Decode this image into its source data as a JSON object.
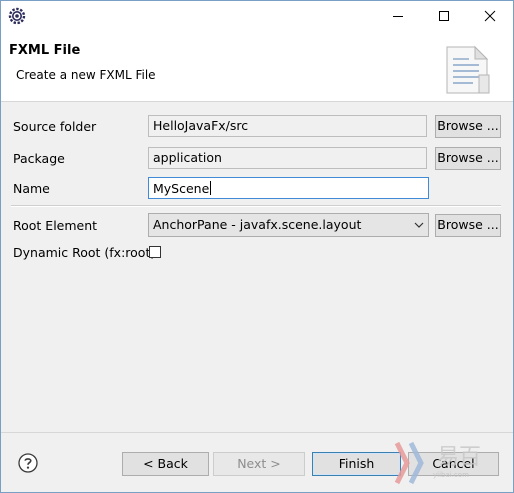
{
  "titlebar": {
    "app_icon": "eclipse-gear-icon",
    "minimize_icon": "minimize-icon",
    "maximize_icon": "maximize-icon",
    "close_icon": "close-icon"
  },
  "banner": {
    "title": "FXML File",
    "description": "Create a new FXML File",
    "icon": "document-icon"
  },
  "form": {
    "source_folder": {
      "label": "Source folder",
      "value": "HelloJavaFx/src",
      "browse": "Browse ..."
    },
    "package": {
      "label": "Package",
      "value": "application",
      "browse": "Browse ..."
    },
    "name": {
      "label": "Name",
      "value": "MyScene"
    },
    "root_element": {
      "label": "Root Element",
      "value": "AnchorPane - javafx.scene.layout",
      "browse": "Browse ..."
    },
    "dynamic_root": {
      "label": "Dynamic Root (fx:root)",
      "checked": false
    }
  },
  "footer": {
    "help_icon": "help-icon",
    "back": "< Back",
    "next": "Next >",
    "finish": "Finish",
    "cancel": "Cancel"
  },
  "watermark": {
    "text": "易百",
    "subtext": "yiibai.com"
  },
  "colors": {
    "accent": "#3f8bd8",
    "window_bg": "#f0f0f0",
    "button_bg": "#e1e1e1"
  }
}
